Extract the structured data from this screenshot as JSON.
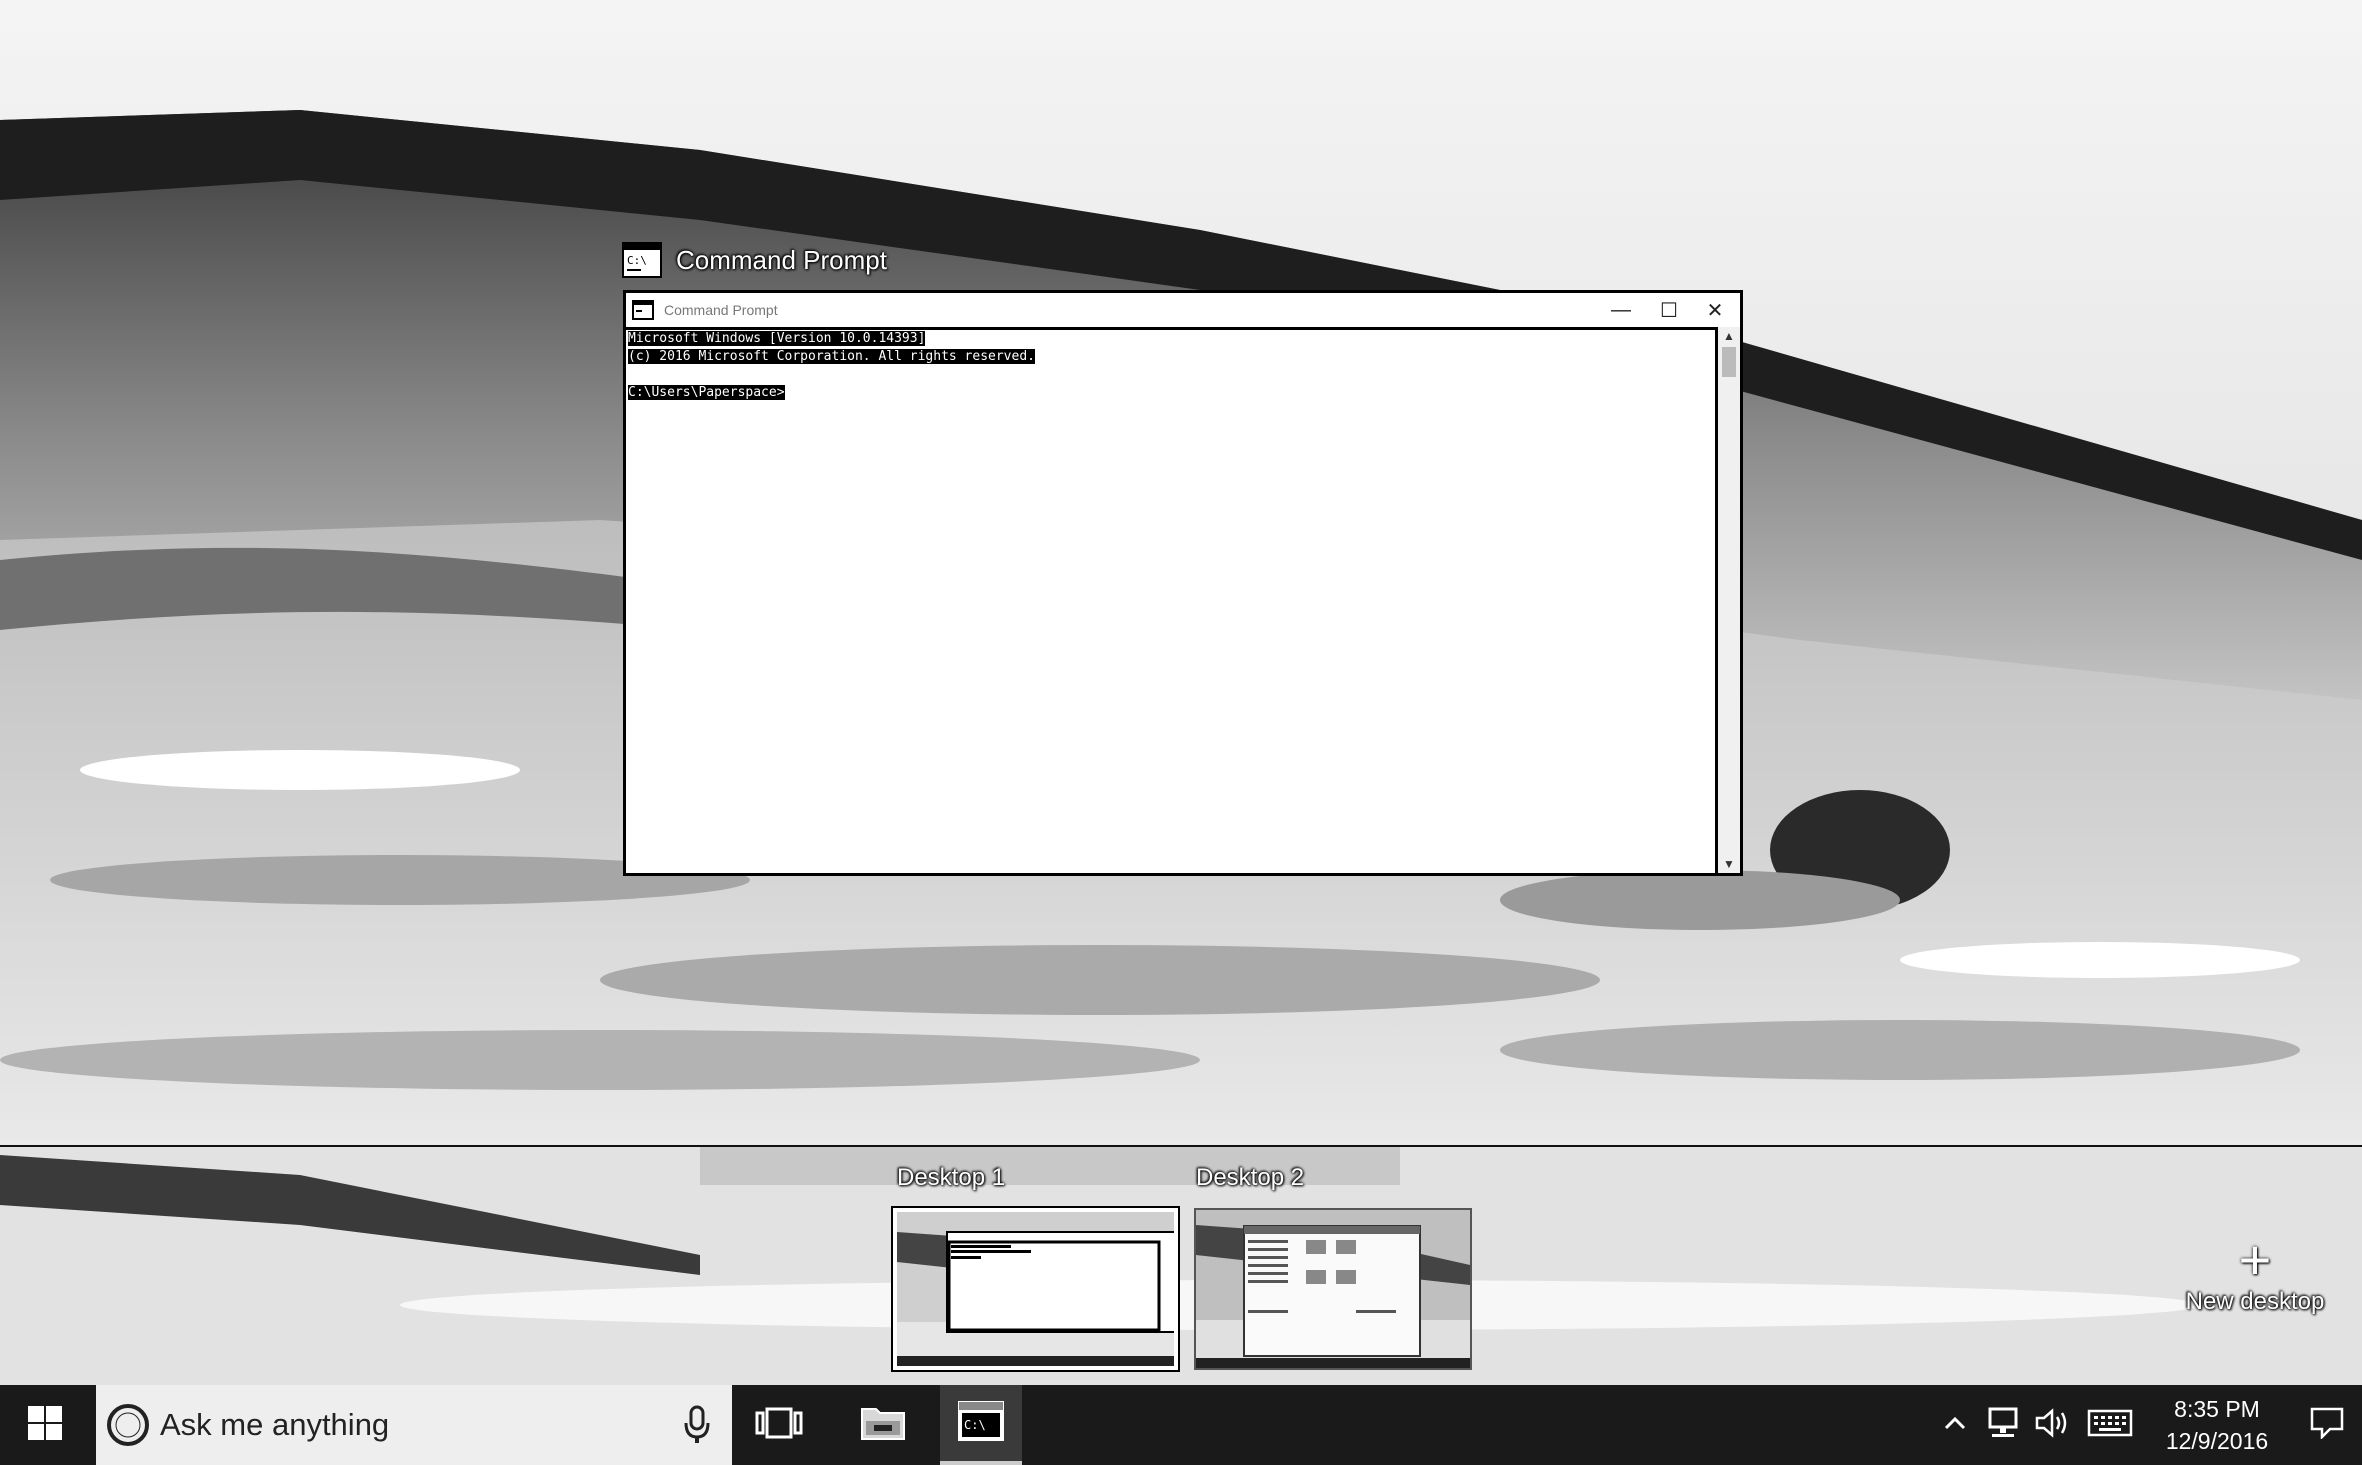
{
  "task_view": {
    "window_caption": "Command Prompt"
  },
  "cmd_window": {
    "title": "Command Prompt",
    "console_lines": [
      "Microsoft Windows [Version 10.0.14393]",
      "(c) 2016 Microsoft Corporation. All rights reserved.",
      "",
      "C:\\Users\\Paperspace>"
    ],
    "controls": {
      "minimize": "—",
      "maximize": "☐",
      "close": "✕"
    }
  },
  "desktops": [
    {
      "label": "Desktop 1",
      "active": true
    },
    {
      "label": "Desktop 2",
      "active": false
    }
  ],
  "new_desktop": {
    "label": "New desktop",
    "icon": "plus-icon"
  },
  "taskbar": {
    "search_placeholder": "Ask me anything",
    "clock_time": "8:35 PM",
    "clock_date": "12/9/2016",
    "icons": [
      "windows-start-icon",
      "cortana-icon",
      "microphone-icon",
      "task-view-icon",
      "file-explorer-icon",
      "command-prompt-icon",
      "chevron-up-icon",
      "network-icon",
      "volume-icon",
      "keyboard-icon",
      "action-center-icon"
    ]
  },
  "colors": {
    "taskbar": "#1a1a1a",
    "search_box": "#eeeeee",
    "window_background": "#ffffff"
  }
}
